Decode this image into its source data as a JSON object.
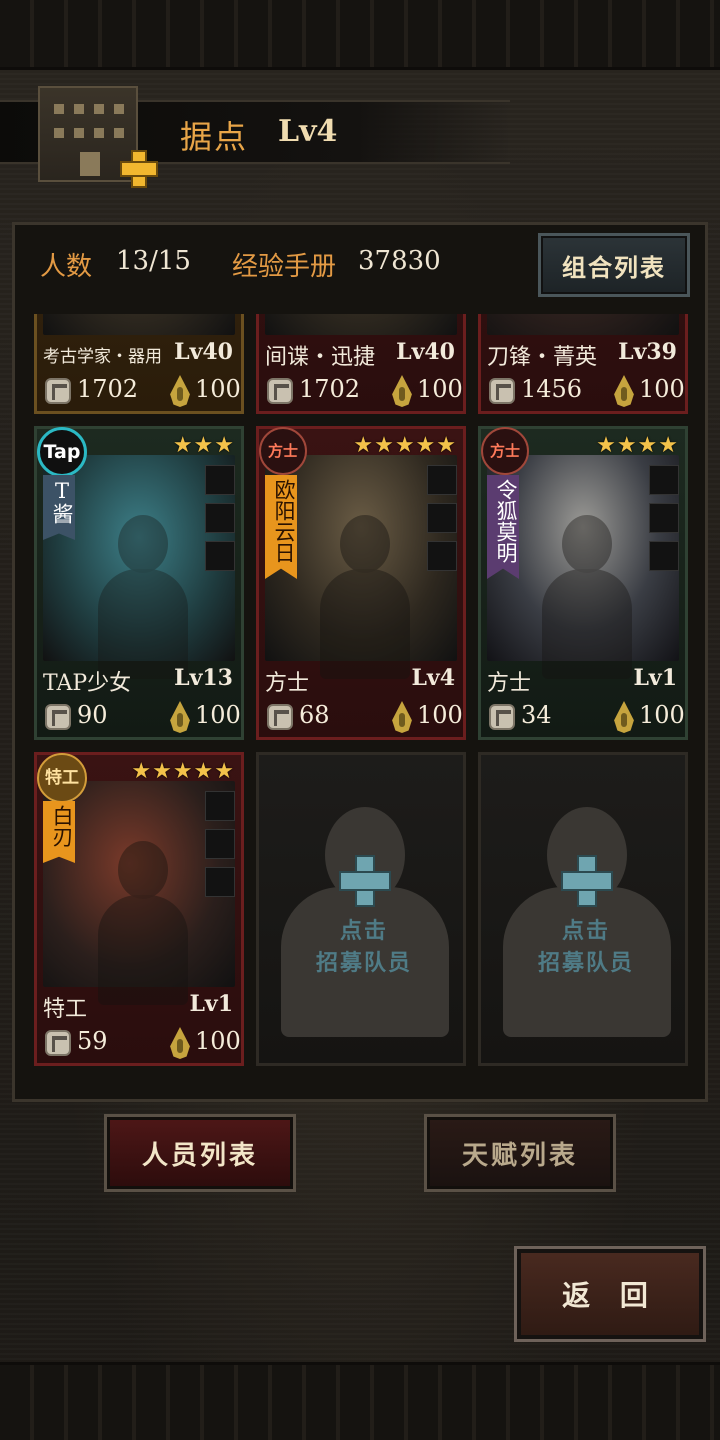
{
  "header": {
    "title": "据点",
    "level": "Lv4"
  },
  "stats": {
    "members_label": "人数",
    "members_value": "13/15",
    "manual_label": "经验手册",
    "manual_value": "37830",
    "combo_button": "组合列表"
  },
  "cards_partial": [
    {
      "title": "考古学家・器用",
      "level": "Lv40",
      "power": "1702",
      "energy": "100"
    },
    {
      "title": "间谍・迅捷",
      "level": "Lv40",
      "power": "1702",
      "energy": "100"
    },
    {
      "title": "刀锋・菁英",
      "level": "Lv39",
      "power": "1456",
      "energy": "100"
    }
  ],
  "cards": [
    {
      "badge": "Tap",
      "stars": "★★★",
      "name": "T酱",
      "class": "TAP少女",
      "level": "Lv13",
      "power": "90",
      "energy": "100"
    },
    {
      "badge": "方士",
      "stars": "★★★★★",
      "name": "欧阳云日",
      "class": "方士",
      "level": "Lv4",
      "power": "68",
      "energy": "100"
    },
    {
      "badge": "方士",
      "stars": "★★★★",
      "name": "令狐莫明",
      "class": "方士",
      "level": "Lv1",
      "power": "34",
      "energy": "100"
    },
    {
      "badge": "特工",
      "stars": "★★★★★",
      "name": "白刃",
      "class": "特工",
      "level": "Lv1",
      "power": "59",
      "energy": "100"
    }
  ],
  "recruit": {
    "line1": "点击",
    "line2": "招募队员"
  },
  "tabs": {
    "members": "人员列表",
    "talents": "天赋列表"
  },
  "back_button": "返 回"
}
